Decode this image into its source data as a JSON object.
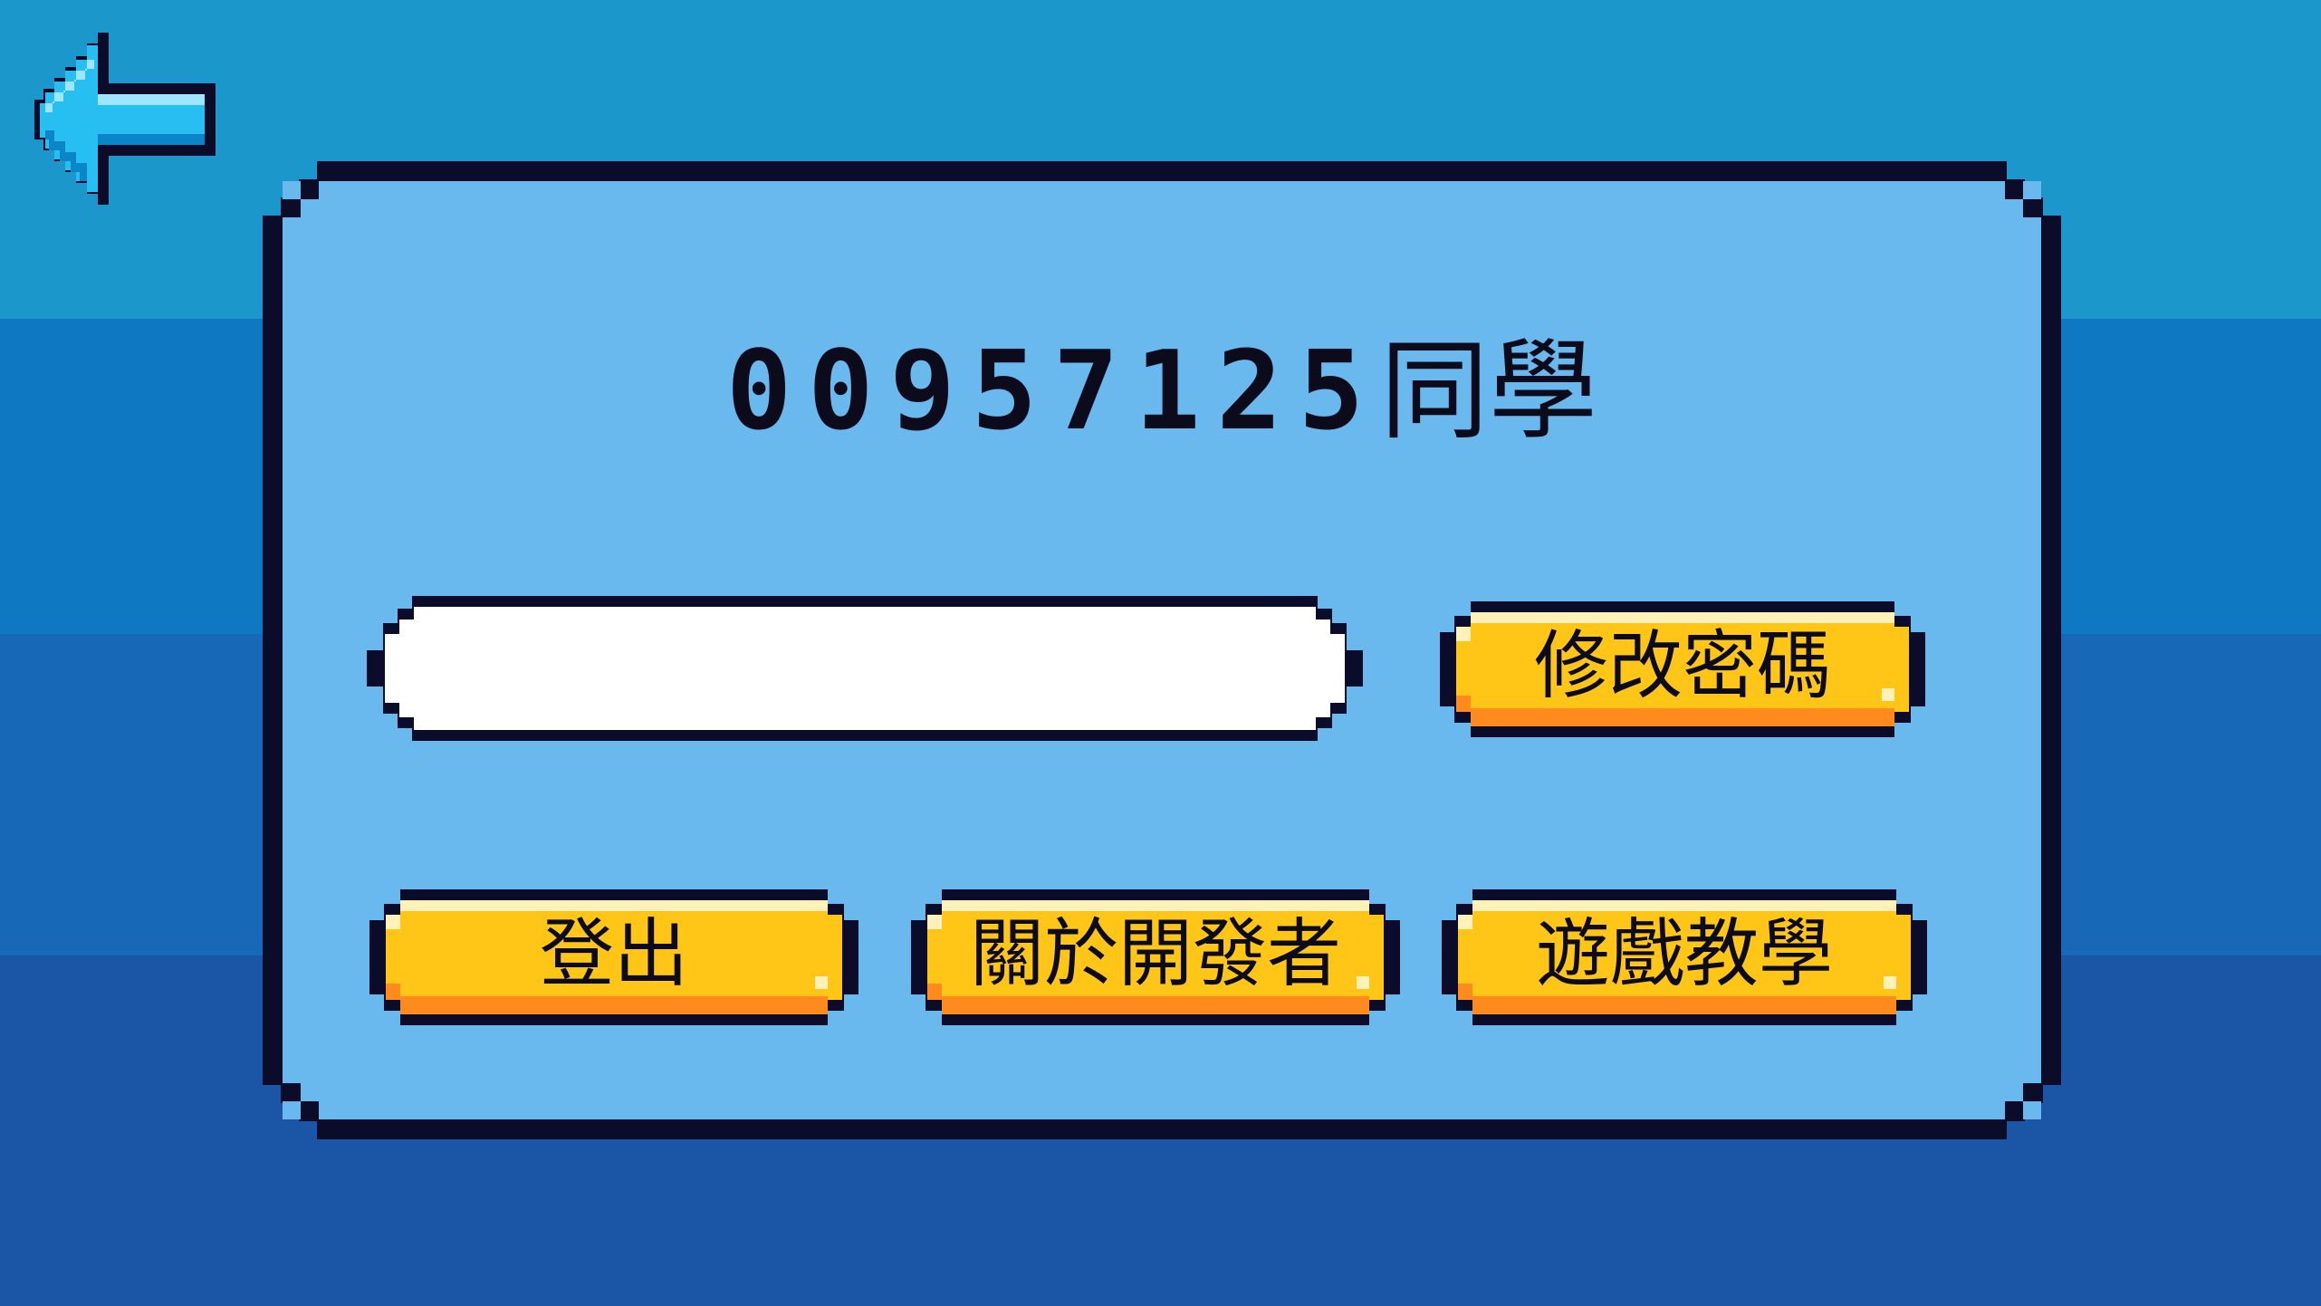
{
  "colors": {
    "bg_band_1": "#1c97cb",
    "bg_band_2": "#0e78c2",
    "bg_band_3": "#1868b8",
    "bg_band_4": "#1b55a6",
    "panel_fill": "#69b9ef",
    "outline": "#0b0b2a",
    "button_fill": "#ffc617",
    "button_shadow": "#ff8a1e",
    "button_highlight": "#fff1b8",
    "arrow_fill": "#27bff2",
    "arrow_light": "#9ee6ff",
    "arrow_dark": "#0a86c8"
  },
  "header": {
    "back_icon": "pixel-left-arrow-icon"
  },
  "profile": {
    "student_id": "00957125",
    "student_suffix": "同學"
  },
  "password_field": {
    "value": "",
    "placeholder": ""
  },
  "buttons": {
    "change_password": "修改密碼",
    "logout": "登出",
    "about_developer": "關於開發者",
    "game_tutorial": "遊戲教學"
  }
}
